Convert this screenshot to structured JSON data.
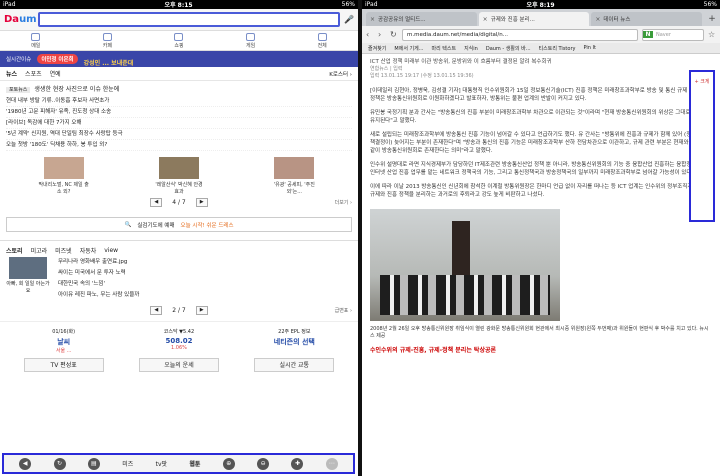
{
  "left": {
    "status": {
      "device": "iPad",
      "time": "오후 8:15",
      "battery": "56%"
    },
    "logo": {
      "main": "Da",
      "accent": "um"
    },
    "nav": [
      {
        "label": "메일",
        "icon": "mail-icon"
      },
      {
        "label": "카페",
        "icon": "cafe-icon"
      },
      {
        "label": "쇼핑",
        "icon": "shopping-icon"
      },
      {
        "label": "게임",
        "icon": "game-icon"
      },
      {
        "label": "전체",
        "icon": "grid-icon"
      }
    ],
    "banner": {
      "label": "실시간이슈",
      "hot": "이민정 이은희",
      "sub": "강성인 ... 보내준대"
    },
    "news_tabs": [
      "뉴스",
      "스포츠",
      "연예"
    ],
    "news_tabs_right": "K로스터 ›",
    "headline": {
      "tag": "포토뉴스",
      "text": "생생한 현장 사진으로 이슈 한눈에"
    },
    "news": [
      "현대 내부 방탈 기류..이동흡 후보자 사면초가",
      "'1980년 고문 피해자' 유족, 진도청 상대 소송",
      "[라이브] 독감에 대한 7가지 오해",
      "'5년 계약' 신지원, 역대 단일팀 최장수 사랑탑 등극",
      "오늘 첫방 '180도' 딕채용 하하, 봉 투입 외?"
    ],
    "photos": [
      {
        "cap": "막내리노벌, NC 제일 출소 외?"
      },
      {
        "cap": "'레알산식' 박신혜 안경 효과"
      },
      {
        "cap": "'유광' 공세피, '주진외'는..."
      }
    ],
    "pager1": {
      "prev": "◀",
      "text": "4 / 7",
      "next": "▶",
      "more": "더보기 ›"
    },
    "more_bar": {
      "text": "실검기도에 예매",
      "accent": "오늘 시작! 쉬운 드레스"
    },
    "story_tabs": [
      "스토리",
      "미고라",
      "미즈넷",
      "자동차",
      "view"
    ],
    "story_thumb_cap": "아빠, 회 일일 아는가요",
    "story_list": [
      "무리나라 영화배우 출연료.jpg",
      "싸이는 미국에서 문 투자 노력",
      "대한민국 속의 '느낌'",
      "아이유 레진 파노, 무는 사람 있을까"
    ],
    "pager2": {
      "prev": "◀",
      "text": "2 / 7",
      "next": "▶",
      "more": "급변표 ›"
    },
    "widgets": [
      {
        "title": "01/16(화)",
        "val": "날씨",
        "sm": "서울 ..."
      },
      {
        "title": "코스닥 ▼5.42",
        "val": "508.02",
        "sm": "1.06%"
      },
      {
        "title": "22주 EPL 정보",
        "val": "네티즌의 선택",
        "sm": ""
      }
    ],
    "widget_buttons": [
      "TV 편성표",
      "오늘의 운세",
      "실시간 교통"
    ],
    "toolbar": {
      "items": [
        "◀",
        "↻",
        "▤",
        "미즈",
        "tv팟",
        "웹툰",
        "⊕",
        "⊖",
        "✚",
        "⋯"
      ]
    }
  },
  "right": {
    "status": {
      "device": "iPad",
      "time": "오후 8:19",
      "battery": "56%"
    },
    "tabs": [
      {
        "label": "공감공유의 멀티드...",
        "active": false
      },
      {
        "label": "규제와 진흥 분리...",
        "active": true
      },
      {
        "label": "데이터 뉴스",
        "active": false
      }
    ],
    "url": "m.media.daum.net/media/digital/n...",
    "search_placeholder": "Naver",
    "bookmarks": [
      "즐겨찾기",
      "M에서 기게...",
      "마리 텍스트",
      "지식in",
      "Daum - 생활의 바...",
      "티스토리 Tistory",
      "Pin It"
    ],
    "kicker": "ICT 산업 정책 미래부 이관 방송위, 문방위와 이 흐름부터 결정된 알려 복수회귀",
    "source": "연합뉴스 | 입력",
    "date": "입력 13.01.15 19:17 (수정 13.01.15 19:36)",
    "paragraphs": [
      "[이데일리 김현아, 정병욱, 김성결 기자] 대통령직 인수위원회가 15일 정보통신기술(ICT) 진흥 정책은 미래창조과학부로 방송 및 통신 규제 정책은 방송통신위원회로 이원화하겠다고 발표하자, 방통위는 불편 업계의 반발이 커지고 있다.",
      "유민봉 국정기획 분과 간사는 \"방송통신의 진흥 부분이 미래창조과학부 차관으로 이관되는 것\"이라며 \"현재 방송통신위원회의 위상은 그대로 유지된다\"고 말했다.",
      "새로 설립되는 미래창조과학부에 방송통신 진흥 기능이 넘어갈 수 있다고 언급하기도 했다. 유 간사는 \"방통위에 진흥과 규제가 함께 있어 (정책결정이) 늦어지는 부분이 존재한다\"며 \"방송과 통신의 진흥 기능은 미래창조과학부 산하 전담차관으로 이관하고, 규제 관련 부분은 현재와 같이 방송통신위원회로 존재한다는 의미\"라고 말했다.",
      "인수위 설명대로 라면 지식경제부가 담당하던 IT제조관련 방송통신산업 정책 뿐 아니라, 방송통신위원회의 기능 중 융합산업 진흥하는 융합정책실과 인터넷 산업 진흥 업무를 맡는 네트워크 정책국의 기능, 그리고 통신정책국과 방송정책국의 일부까지 미래창조과학부로 넘어갈 가능성이 있다.",
      "이에 따라 이날 2013 방송통신인 신년회에 참석한 이계철 방통위원장은 한마디 언급 없이 자리를 떠나는 등 ICT 업계는 인수위의 정부조직개편안이 규제와 진흥 정책을 분리하는 과거로의 후퇴라고 강도 높게 비판하고 나섰다."
    ],
    "photo_caption": "2008년 2월 26일 오후 방송통신위원장 취임식이 열린 광화문 방송통신위원회 현관에서 최시중 위원장(왼쪽 두번째)과 위원들이 현판식 후 박수를 치고 있다. 뉴시스 제공",
    "subhead": "수인수위의 규제-진흥, 규제-정책 분리는 탁상공론",
    "side_label": "+ 크게"
  }
}
